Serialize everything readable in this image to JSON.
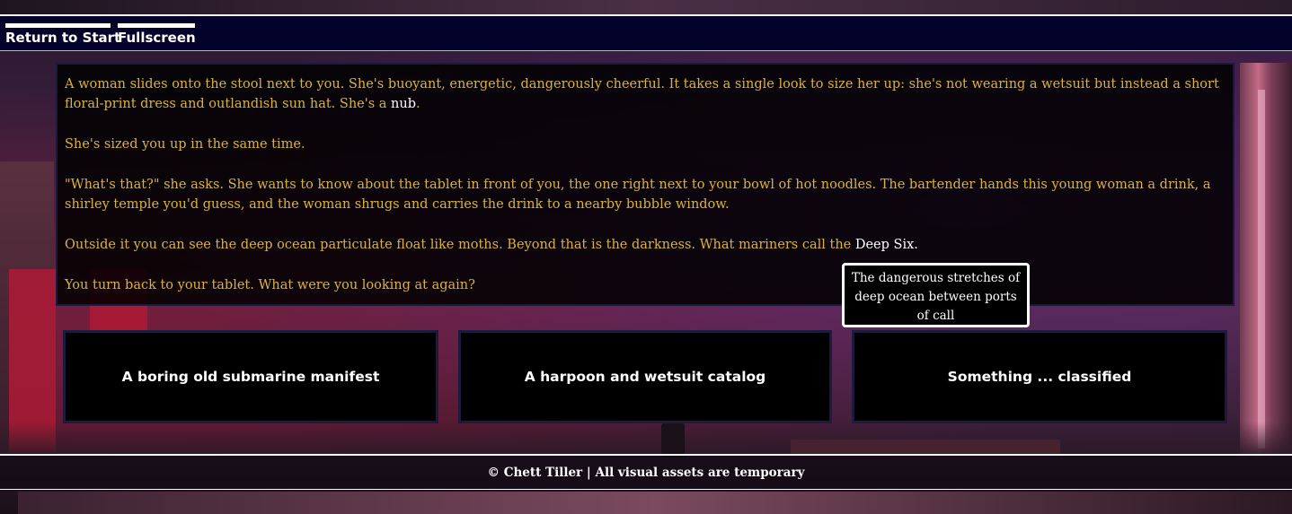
{
  "nav": {
    "return_label": "Return to Start",
    "fullscreen_label": "Fullscreen"
  },
  "story": {
    "p1_before": "A woman slides onto the stool next to you. She's buoyant, energetic, dangerously cheerful. It takes a single look to size her up: she's not wearing a wetsuit but instead a short floral-print dress and outlandish sun hat. She's a ",
    "p1_keyword": "nub",
    "p1_after": ".",
    "p2": "She's sized you up in the same time.",
    "p3": "\"What's that?\" she asks. She wants to know about the tablet in front of you, the one right next to your bowl of hot noodles. The bartender hands this young woman a drink, a shirley temple you'd guess, and the woman shrugs and carries the drink to a nearby bubble window.",
    "p4_before": "Outside it you can see the deep ocean particulate float like moths. Beyond that is the darkness. What mariners call the ",
    "p4_keyword": "Deep Six.",
    "p5": "You turn back to your tablet. What were you looking at again?"
  },
  "tooltip": {
    "text": "The dangerous stretches of deep ocean between ports of call"
  },
  "choices": [
    {
      "label": "A boring old submarine manifest"
    },
    {
      "label": "A harpoon and wetsuit catalog"
    },
    {
      "label": "Something ... classified"
    }
  ],
  "footer": {
    "text": "© Chett Tiller | All visual assets are temporary"
  },
  "colors": {
    "story_text": "#d9b43a",
    "keyword": "#ffffff",
    "topbar": "#03022a",
    "panel_border": "#1d1b3d"
  }
}
